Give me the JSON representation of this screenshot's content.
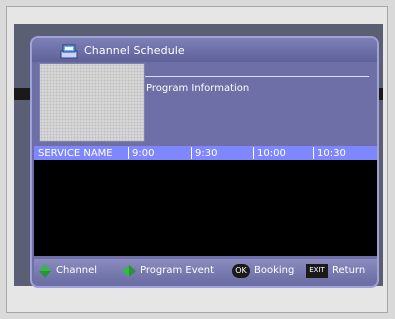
{
  "header": {
    "title": "Channel Schedule",
    "icon": "channel-schedule-icon"
  },
  "preview": {
    "label": "Program Information"
  },
  "timeline": {
    "service_name": "SERVICE NAME",
    "times": [
      "9:00",
      "9:30",
      "10:00",
      "10:30"
    ]
  },
  "footer": {
    "channel_label": "Channel",
    "program_event_label": "Program Event",
    "ok_icon_text": "OK",
    "booking_label": "Booking",
    "exit_icon_text": "EXIT",
    "return_label": "Return"
  },
  "colors": {
    "panel": "#6d6fa6",
    "timeline": "#7f87ff",
    "accent_green": "#39b54a",
    "background": "#d9d9d9"
  }
}
